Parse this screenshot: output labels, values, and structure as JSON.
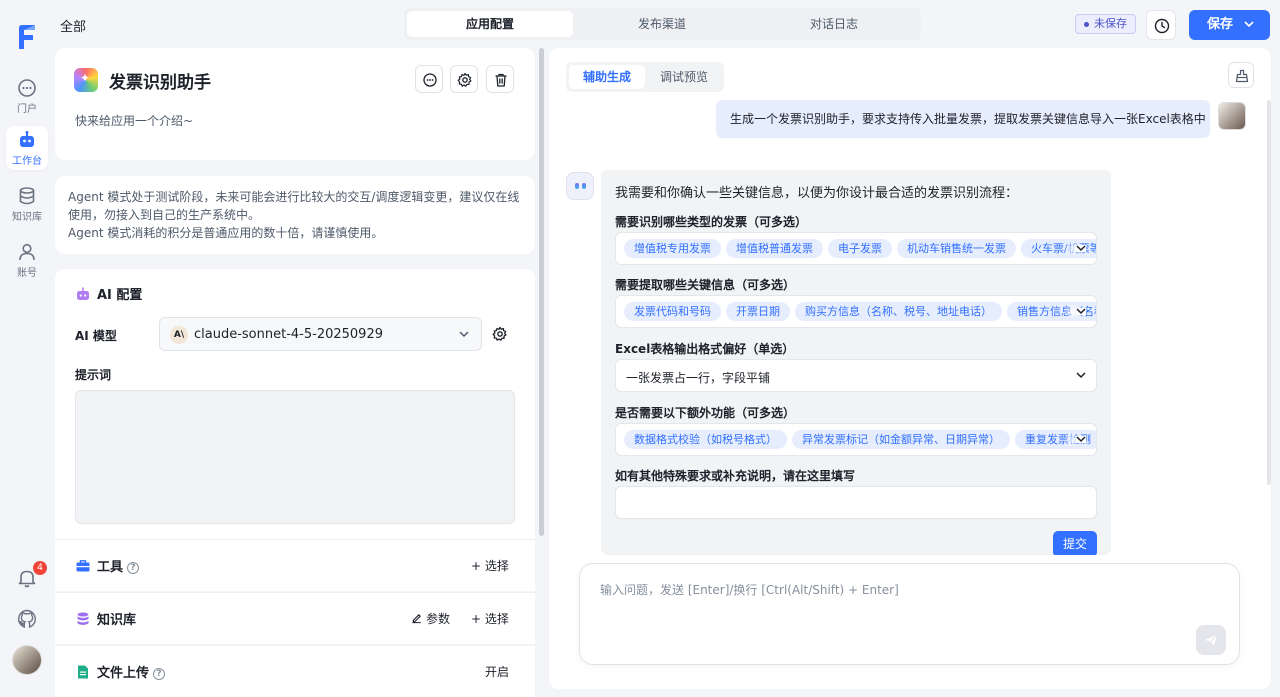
{
  "rail": {
    "items": [
      {
        "label": "门户",
        "icon": "chat-bubble-icon"
      },
      {
        "label": "工作台",
        "icon": "robot-icon",
        "active": true
      },
      {
        "label": "知识库",
        "icon": "database-icon"
      },
      {
        "label": "账号",
        "icon": "user-icon"
      }
    ],
    "notification_count": "4"
  },
  "header": {
    "breadcrumb": "全部",
    "tabs": [
      {
        "label": "应用配置",
        "active": true
      },
      {
        "label": "发布渠道"
      },
      {
        "label": "对话日志"
      }
    ],
    "unsaved_label": "未保存",
    "save_label": "保存",
    "accent_color": "#3370ff"
  },
  "app": {
    "name": "发票识别助手",
    "intro_placeholder": "快来给应用一个介绍~"
  },
  "notice": {
    "line1": "Agent 模式处于测试阶段，未来可能会进行比较大的交互/调度逻辑变更，建议仅在线使用，勿接入到自己的生产系统中。",
    "line2": "Agent 模式消耗的积分是普通应用的数十倍，请谨慎使用。"
  },
  "config": {
    "section_title": "AI 配置",
    "model_label": "AI 模型",
    "model_badge": "A\\",
    "model_name": "claude-sonnet-4-5-20250929",
    "prompt_label": "提示词",
    "prompt_value": ""
  },
  "rows": {
    "tools": {
      "title": "工具",
      "help": "?",
      "select": "+ 选择"
    },
    "knowledge": {
      "title": "知识库",
      "params": "参数",
      "select": "+ 选择"
    },
    "file_upload": {
      "title": "文件上传",
      "help": "?",
      "toggle": "开启"
    }
  },
  "right": {
    "tabs": [
      {
        "label": "辅助生成",
        "active": true
      },
      {
        "label": "调试预览"
      }
    ],
    "user_message": "生成一个发票识别助手，要求支持传入批量发票，提取发票关键信息导入一张Excel表格中",
    "bot_intro": "我需要和你确认一些关键信息，以便为你设计最合适的发票识别流程：",
    "questions": [
      {
        "label": "需要识别哪些类型的发票（可多选）",
        "tags": [
          "增值税专用发票",
          "增值税普通发票",
          "电子发票",
          "机动车销售统一发票",
          "火车票/机票等行程单"
        ]
      },
      {
        "label": "需要提取哪些关键信息（可多选）",
        "tags": [
          "发票代码和号码",
          "开票日期",
          "购买方信息（名称、税号、地址电话）",
          "销售方信息（名称、税号）"
        ]
      },
      {
        "label": "Excel表格输出格式偏好（单选）",
        "value": "一张发票占一行，字段平铺"
      },
      {
        "label": "是否需要以下额外功能（可多选）",
        "tags": [
          "数据格式校验（如税号格式）",
          "异常发票标记（如金额异常、日期异常）",
          "重复发票检测"
        ]
      },
      {
        "label": "如有其他特殊要求或补充说明，请在这里填写",
        "value": ""
      }
    ],
    "submit_label": "提交",
    "input_placeholder": "输入问题，发送 [Enter]/换行 [Ctrl(Alt/Shift) + Enter]"
  }
}
